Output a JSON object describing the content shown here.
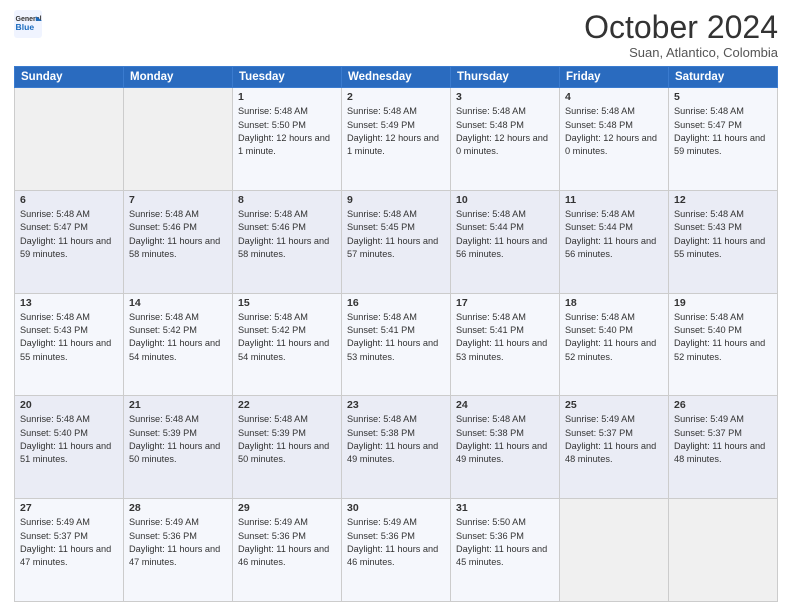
{
  "header": {
    "logo_line1": "General",
    "logo_line2": "Blue",
    "month": "October 2024",
    "location": "Suan, Atlantico, Colombia"
  },
  "weekdays": [
    "Sunday",
    "Monday",
    "Tuesday",
    "Wednesday",
    "Thursday",
    "Friday",
    "Saturday"
  ],
  "weeks": [
    [
      {
        "day": "",
        "sunrise": "",
        "sunset": "",
        "daylight": ""
      },
      {
        "day": "",
        "sunrise": "",
        "sunset": "",
        "daylight": ""
      },
      {
        "day": "1",
        "sunrise": "Sunrise: 5:48 AM",
        "sunset": "Sunset: 5:50 PM",
        "daylight": "Daylight: 12 hours and 1 minute."
      },
      {
        "day": "2",
        "sunrise": "Sunrise: 5:48 AM",
        "sunset": "Sunset: 5:49 PM",
        "daylight": "Daylight: 12 hours and 1 minute."
      },
      {
        "day": "3",
        "sunrise": "Sunrise: 5:48 AM",
        "sunset": "Sunset: 5:48 PM",
        "daylight": "Daylight: 12 hours and 0 minutes."
      },
      {
        "day": "4",
        "sunrise": "Sunrise: 5:48 AM",
        "sunset": "Sunset: 5:48 PM",
        "daylight": "Daylight: 12 hours and 0 minutes."
      },
      {
        "day": "5",
        "sunrise": "Sunrise: 5:48 AM",
        "sunset": "Sunset: 5:47 PM",
        "daylight": "Daylight: 11 hours and 59 minutes."
      }
    ],
    [
      {
        "day": "6",
        "sunrise": "Sunrise: 5:48 AM",
        "sunset": "Sunset: 5:47 PM",
        "daylight": "Daylight: 11 hours and 59 minutes."
      },
      {
        "day": "7",
        "sunrise": "Sunrise: 5:48 AM",
        "sunset": "Sunset: 5:46 PM",
        "daylight": "Daylight: 11 hours and 58 minutes."
      },
      {
        "day": "8",
        "sunrise": "Sunrise: 5:48 AM",
        "sunset": "Sunset: 5:46 PM",
        "daylight": "Daylight: 11 hours and 58 minutes."
      },
      {
        "day": "9",
        "sunrise": "Sunrise: 5:48 AM",
        "sunset": "Sunset: 5:45 PM",
        "daylight": "Daylight: 11 hours and 57 minutes."
      },
      {
        "day": "10",
        "sunrise": "Sunrise: 5:48 AM",
        "sunset": "Sunset: 5:44 PM",
        "daylight": "Daylight: 11 hours and 56 minutes."
      },
      {
        "day": "11",
        "sunrise": "Sunrise: 5:48 AM",
        "sunset": "Sunset: 5:44 PM",
        "daylight": "Daylight: 11 hours and 56 minutes."
      },
      {
        "day": "12",
        "sunrise": "Sunrise: 5:48 AM",
        "sunset": "Sunset: 5:43 PM",
        "daylight": "Daylight: 11 hours and 55 minutes."
      }
    ],
    [
      {
        "day": "13",
        "sunrise": "Sunrise: 5:48 AM",
        "sunset": "Sunset: 5:43 PM",
        "daylight": "Daylight: 11 hours and 55 minutes."
      },
      {
        "day": "14",
        "sunrise": "Sunrise: 5:48 AM",
        "sunset": "Sunset: 5:42 PM",
        "daylight": "Daylight: 11 hours and 54 minutes."
      },
      {
        "day": "15",
        "sunrise": "Sunrise: 5:48 AM",
        "sunset": "Sunset: 5:42 PM",
        "daylight": "Daylight: 11 hours and 54 minutes."
      },
      {
        "day": "16",
        "sunrise": "Sunrise: 5:48 AM",
        "sunset": "Sunset: 5:41 PM",
        "daylight": "Daylight: 11 hours and 53 minutes."
      },
      {
        "day": "17",
        "sunrise": "Sunrise: 5:48 AM",
        "sunset": "Sunset: 5:41 PM",
        "daylight": "Daylight: 11 hours and 53 minutes."
      },
      {
        "day": "18",
        "sunrise": "Sunrise: 5:48 AM",
        "sunset": "Sunset: 5:40 PM",
        "daylight": "Daylight: 11 hours and 52 minutes."
      },
      {
        "day": "19",
        "sunrise": "Sunrise: 5:48 AM",
        "sunset": "Sunset: 5:40 PM",
        "daylight": "Daylight: 11 hours and 52 minutes."
      }
    ],
    [
      {
        "day": "20",
        "sunrise": "Sunrise: 5:48 AM",
        "sunset": "Sunset: 5:40 PM",
        "daylight": "Daylight: 11 hours and 51 minutes."
      },
      {
        "day": "21",
        "sunrise": "Sunrise: 5:48 AM",
        "sunset": "Sunset: 5:39 PM",
        "daylight": "Daylight: 11 hours and 50 minutes."
      },
      {
        "day": "22",
        "sunrise": "Sunrise: 5:48 AM",
        "sunset": "Sunset: 5:39 PM",
        "daylight": "Daylight: 11 hours and 50 minutes."
      },
      {
        "day": "23",
        "sunrise": "Sunrise: 5:48 AM",
        "sunset": "Sunset: 5:38 PM",
        "daylight": "Daylight: 11 hours and 49 minutes."
      },
      {
        "day": "24",
        "sunrise": "Sunrise: 5:48 AM",
        "sunset": "Sunset: 5:38 PM",
        "daylight": "Daylight: 11 hours and 49 minutes."
      },
      {
        "day": "25",
        "sunrise": "Sunrise: 5:49 AM",
        "sunset": "Sunset: 5:37 PM",
        "daylight": "Daylight: 11 hours and 48 minutes."
      },
      {
        "day": "26",
        "sunrise": "Sunrise: 5:49 AM",
        "sunset": "Sunset: 5:37 PM",
        "daylight": "Daylight: 11 hours and 48 minutes."
      }
    ],
    [
      {
        "day": "27",
        "sunrise": "Sunrise: 5:49 AM",
        "sunset": "Sunset: 5:37 PM",
        "daylight": "Daylight: 11 hours and 47 minutes."
      },
      {
        "day": "28",
        "sunrise": "Sunrise: 5:49 AM",
        "sunset": "Sunset: 5:36 PM",
        "daylight": "Daylight: 11 hours and 47 minutes."
      },
      {
        "day": "29",
        "sunrise": "Sunrise: 5:49 AM",
        "sunset": "Sunset: 5:36 PM",
        "daylight": "Daylight: 11 hours and 46 minutes."
      },
      {
        "day": "30",
        "sunrise": "Sunrise: 5:49 AM",
        "sunset": "Sunset: 5:36 PM",
        "daylight": "Daylight: 11 hours and 46 minutes."
      },
      {
        "day": "31",
        "sunrise": "Sunrise: 5:50 AM",
        "sunset": "Sunset: 5:36 PM",
        "daylight": "Daylight: 11 hours and 45 minutes."
      },
      {
        "day": "",
        "sunrise": "",
        "sunset": "",
        "daylight": ""
      },
      {
        "day": "",
        "sunrise": "",
        "sunset": "",
        "daylight": ""
      }
    ]
  ]
}
